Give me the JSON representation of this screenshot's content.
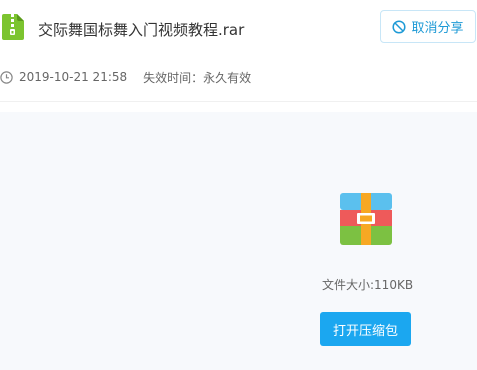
{
  "file": {
    "name": "交际舞国标舞入门视频教程.rar",
    "icon": "archive-file-icon",
    "size_text": "文件大小:110KB"
  },
  "actions": {
    "cancel_share_label": "取消分享",
    "cancel_share_icon": "ban-icon",
    "open_archive_label": "打开压缩包"
  },
  "meta": {
    "date": "2019-10-21 21:58",
    "expiry_label": "失效时间：",
    "expiry_value": "永久有效"
  },
  "colors": {
    "accent": "#1ba7f0",
    "link": "#1e9ad6",
    "file_icon_green": "#7cc42f",
    "content_bg": "#f7f9fc"
  }
}
